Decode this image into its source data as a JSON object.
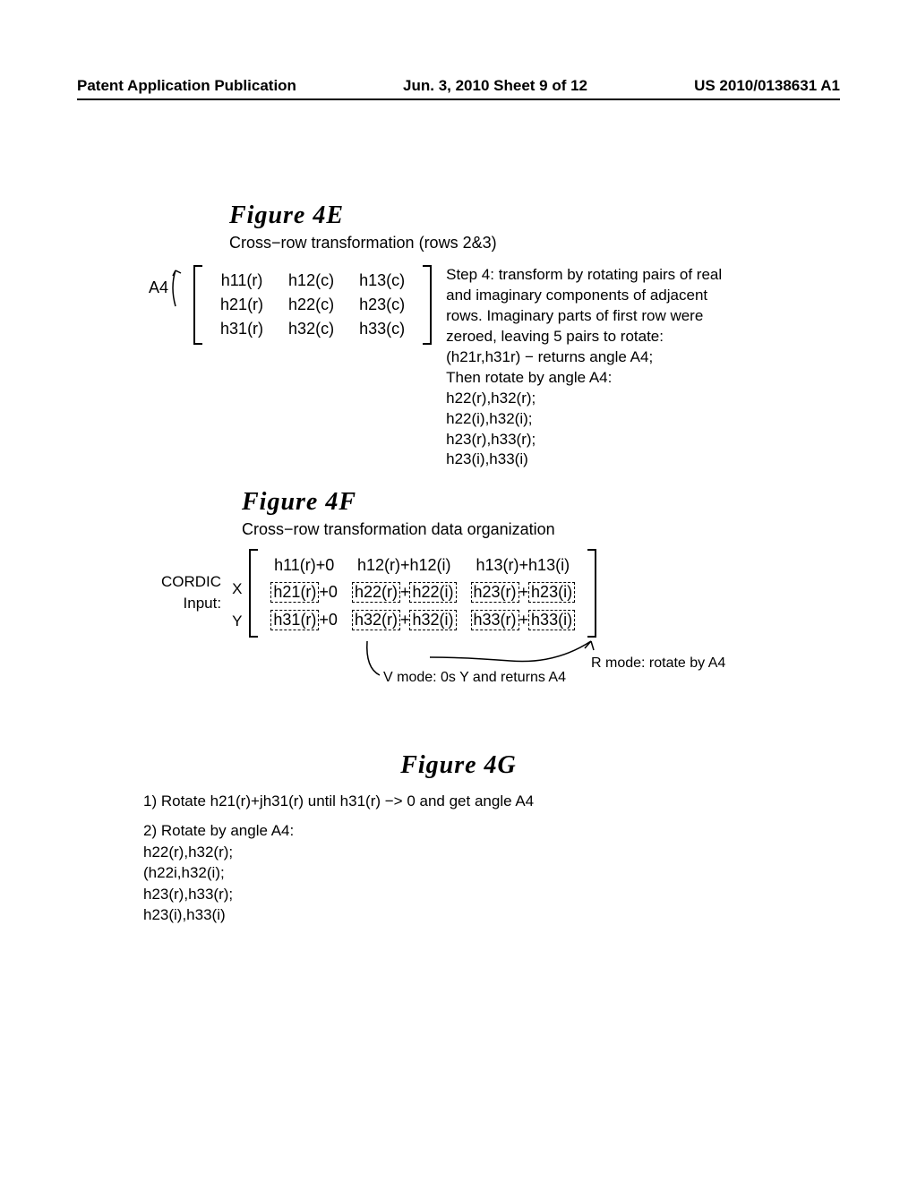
{
  "header": {
    "left": "Patent Application Publication",
    "mid": "Jun. 3, 2010  Sheet 9 of 12",
    "right": "US 2010/0138631 A1"
  },
  "fig4e": {
    "title": "Figure  4E",
    "caption": "Cross−row transformation (rows 2&3)",
    "a4": "A4",
    "m": [
      [
        "h11(r)",
        "h12(c)",
        "h13(c)"
      ],
      [
        "h21(r)",
        "h22(c)",
        "h23(c)"
      ],
      [
        "h31(r)",
        "h32(c)",
        "h33(c)"
      ]
    ],
    "desc_intro": "Step 4: transform by rotating pairs of real and imaginary components of adjacent rows.  Imaginary parts of first row were zeroed, leaving 5 pairs to rotate:",
    "line1": "(h21r,h31r) − returns angle A4;",
    "line2": "Then rotate by angle A4:",
    "p1": "h22(r),h32(r);",
    "p2": "h22(i),h32(i);",
    "p3": "h23(r),h33(r);",
    "p4": "h23(i),h33(i)"
  },
  "fig4f": {
    "title": "Figure  4F",
    "caption": "Cross−row transformation data organization",
    "cordic": "CORDIC",
    "input": "Input:",
    "x": "X",
    "y": "Y",
    "row1": {
      "c1": "h11(r)+0",
      "c2": "h12(r)+h12(i)",
      "c3": "h13(r)+h13(i)"
    },
    "row2": {
      "c1a": "h21(r)",
      "c1b": "+0",
      "c2a": "h22(r)",
      "c2p": "+",
      "c2b": "h22(i)",
      "c3a": "h23(r)",
      "c3p": "+",
      "c3b": "h23(i)"
    },
    "row3": {
      "c1a": "h31(r)",
      "c1b": "+0",
      "c2a": "h32(r)",
      "c2p": "+",
      "c2b": "h32(i)",
      "c3a": "h33(r)",
      "c3p": "+",
      "c3b": "h33(i)"
    },
    "rmode": "R mode: rotate by A4",
    "vmode": "V mode: 0s Y and returns A4"
  },
  "fig4g": {
    "title": "Figure  4G",
    "step1": "1) Rotate h21(r)+jh31(r) until h31(r) −> 0 and get angle A4",
    "step2": "2) Rotate by angle A4:",
    "l1": "h22(r),h32(r);",
    "l2": "(h22i,h32(i);",
    "l3": "h23(r),h33(r);",
    "l4": "h23(i),h33(i)"
  }
}
